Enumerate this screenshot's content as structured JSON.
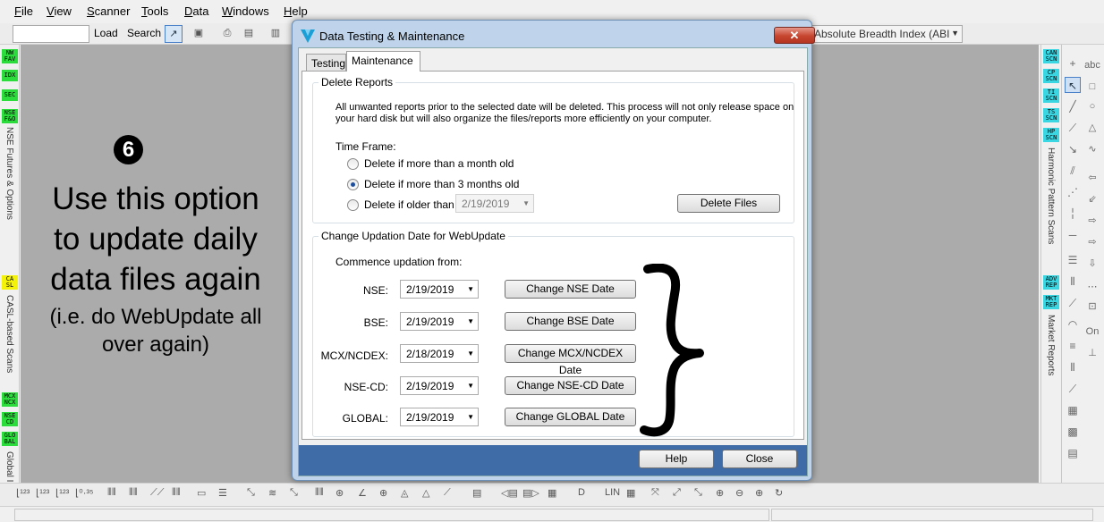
{
  "menu": [
    "File",
    "View",
    "Scanner",
    "Tools",
    "Data",
    "Windows",
    "Help"
  ],
  "toolbar": {
    "symbol_value": "",
    "load_label": "Load",
    "search_label": "Search",
    "indicator_value": "Absolute Breadth Index (ABI"
  },
  "left_panel": {
    "chips": [
      "NW\nFAV",
      "IDX",
      "SEC",
      "NSE\nF&O",
      "CA\nSL",
      "MCX\nNCX",
      "NSE\nCD",
      "GLO\nBAL"
    ],
    "labels": [
      "NSE Futures & Options",
      "CASL-based Scans",
      "Global I"
    ]
  },
  "right_panel": {
    "chips": [
      "CAN\nSCN",
      "CP\nSCN",
      "TI\nSCN",
      "TS\nSCN",
      "HP\nSCN",
      "ADV\nREP",
      "MKT\nREP"
    ],
    "labels": [
      "Harmonic Pattern Scans",
      "Market Reports"
    ],
    "tools_text": [
      "abc",
      "On"
    ]
  },
  "annotation": {
    "number": "6",
    "main_text": "Use this option to update daily data files again",
    "sub_text": "(i.e. do WebUpdate all over again)"
  },
  "dialog": {
    "title": "Data Testing & Maintenance",
    "close_label": "✕",
    "tabs": [
      "Testing",
      "Maintenance"
    ],
    "active_tab": "Maintenance",
    "delete_reports": {
      "title": "Delete Reports",
      "description_line1": "All unwanted reports prior to the selected date will be deleted. This process will not only release space on",
      "description_line2": "your hard disk but will also organize the files/reports more efficiently on your computer.",
      "timeframe_label": "Time Frame:",
      "options": [
        "Delete if more than a month old",
        "Delete if more than 3 months old",
        "Delete if older than"
      ],
      "selected_option": "Delete if more than 3 months old",
      "older_than_date": "2/19/2019",
      "delete_button": "Delete Files"
    },
    "updation": {
      "title": "Change Updation Date for WebUpdate",
      "commence_label": "Commence updation from:",
      "rows": [
        {
          "label": "NSE:",
          "date": "2/19/2019",
          "button": "Change NSE Date"
        },
        {
          "label": "BSE:",
          "date": "2/19/2019",
          "button": "Change BSE Date"
        },
        {
          "label": "MCX/NCDEX:",
          "date": "2/18/2019",
          "button": "Change MCX/NCDEX Date"
        },
        {
          "label": "NSE-CD:",
          "date": "2/19/2019",
          "button": "Change NSE-CD Date"
        },
        {
          "label": "GLOBAL:",
          "date": "2/19/2019",
          "button": "Change GLOBAL Date"
        }
      ]
    },
    "footer": {
      "help_button": "Help",
      "close_button": "Close"
    }
  },
  "colors": {
    "canvas": "#ababab",
    "dialog_footer": "#3f6ba6",
    "chip_green": "#2bdc3c",
    "chip_yellow": "#f5f20a",
    "chip_cyan": "#3ad6e2"
  }
}
